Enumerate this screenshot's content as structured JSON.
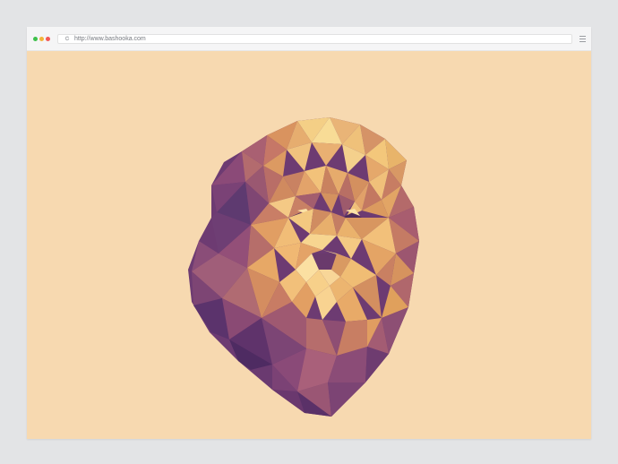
{
  "browser": {
    "url": "http://www.bashooka.com",
    "icons": {
      "reload": "reload-icon",
      "menu": "hamburger-menu-icon"
    },
    "window_controls": [
      "close",
      "minimize",
      "maximize"
    ]
  },
  "colors": {
    "page_background": "#f7d9b0",
    "outer_background": "#e3e4e6",
    "toolbar": "#f5f5f6",
    "accent_purple": "#6a3a73",
    "accent_orange": "#e3a159"
  },
  "artwork": {
    "subject": "low-poly-lion-head"
  }
}
